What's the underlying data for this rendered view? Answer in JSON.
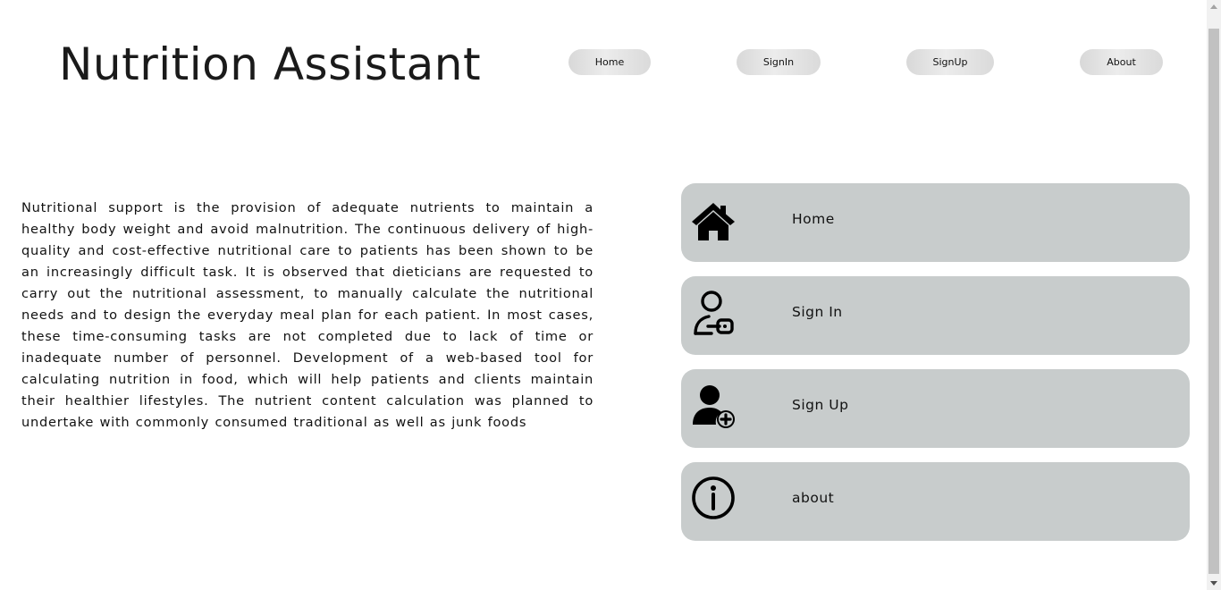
{
  "header": {
    "title": "Nutrition Assistant"
  },
  "nav": {
    "home": "Home",
    "signin": "SignIn",
    "signup": "SignUp",
    "about": "About"
  },
  "intro": {
    "text": "Nutritional support is the provision of adequate nutrients to maintain a healthy body weight and avoid malnutrition. The continuous delivery of high-quality and cost-effective nutritional care to patients has been shown to be an increasingly difficult task. It is observed that dieticians are requested to carry out the nutritional assessment, to manually calculate the nutritional needs and to design the everyday meal plan for each patient. In most cases, these time-consuming tasks are not completed due to lack of time or inadequate number of personnel. Development of a web-based tool for calculating nutrition in food, which will help patients and clients maintain their healthier lifestyles. The nutrient content calculation was planned to undertake with commonly consumed traditional as well as junk foods"
  },
  "cards": [
    {
      "label": "Home",
      "icon": "home-icon"
    },
    {
      "label": "Sign In",
      "icon": "user-key-icon"
    },
    {
      "label": "Sign Up",
      "icon": "user-add-icon"
    },
    {
      "label": "about",
      "icon": "info-icon"
    }
  ],
  "colors": {
    "card_bg": "#c8cccc",
    "nav_bg": "#e4e4e4",
    "text": "#111111"
  }
}
